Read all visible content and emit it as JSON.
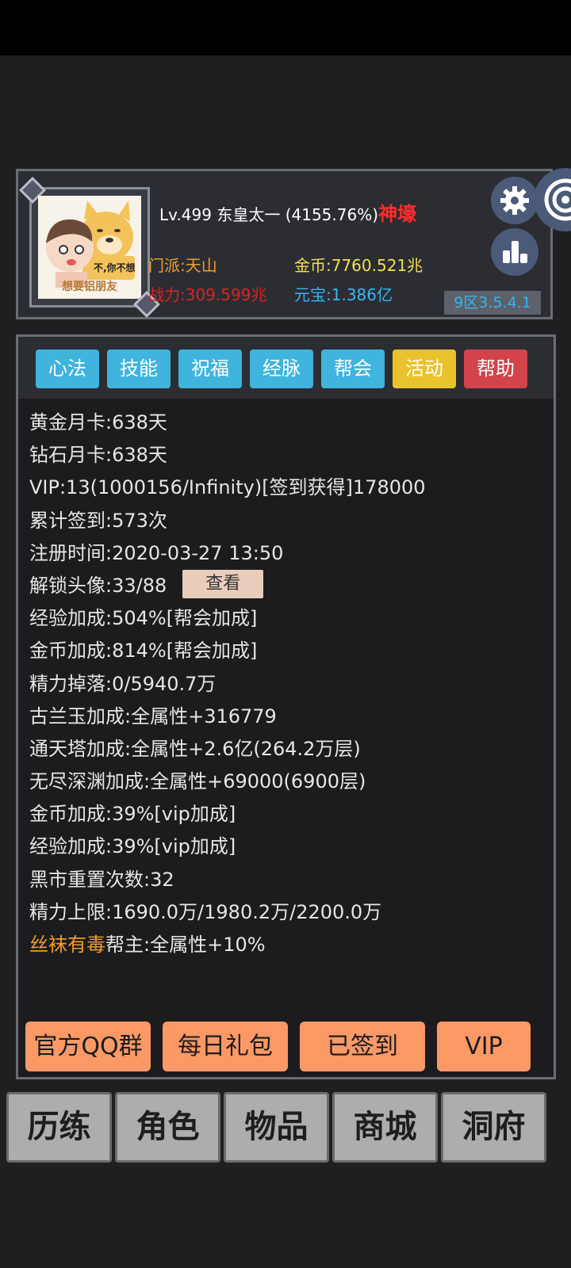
{
  "profile": {
    "level": "Lv.499",
    "name": "东皇太一",
    "percent": "(4155.76%)",
    "title": "神壕",
    "avatar_caption": "想要铝朋友",
    "avatar_bubble": "不,你不想",
    "sect": "门派:天山",
    "gold": "金币:7760.521兆",
    "power": "战力:309.599兆",
    "ingot": "元宝:1.386亿",
    "version": "9区3.5.4.1",
    "icons": {
      "settings": "gear-icon",
      "rank": "bar-chart-icon",
      "swirl": "swirl-icon"
    }
  },
  "tabs": [
    {
      "label": "心法",
      "color": "#3fb4dc"
    },
    {
      "label": "技能",
      "color": "#3fb4dc"
    },
    {
      "label": "祝福",
      "color": "#3fb4dc"
    },
    {
      "label": "经脉",
      "color": "#3fb4dc"
    },
    {
      "label": "帮会",
      "color": "#3fb4dc"
    },
    {
      "label": "活动",
      "color": "#e9c22c"
    },
    {
      "label": "帮助",
      "color": "#d2434a"
    }
  ],
  "info": [
    "黄金月卡:638天",
    "钻石月卡:638天",
    "VIP:13(1000156/Infinity)[签到获得]178000",
    "累计签到:573次",
    "注册时间:2020-03-27 13:50",
    "解锁头像:33/88",
    "经验加成:504%[帮会加成]",
    "金币加成:814%[帮会加成]",
    "精力掉落:0/5940.7万",
    "古兰玉加成:全属性+316779",
    "通天塔加成:全属性+2.6亿(264.2万层)",
    "无尽深渊加成:全属性+69000(6900层)",
    "金币加成:39%[vip加成]",
    "经验加成:39%[vip加成]",
    "黑市重置次数:32",
    "精力上限:1690.0万/1980.2万/2200.0万"
  ],
  "view_button": "查看",
  "leader": {
    "name": "丝袜有毒",
    "text": "帮主:全属性+10%"
  },
  "actions": [
    "官方QQ群",
    "每日礼包",
    "已签到",
    "VIP"
  ],
  "nav": [
    "历练",
    "角色",
    "物品",
    "商城",
    "洞府"
  ],
  "colors": {
    "accent_orange": "#fa9966",
    "tab_blue": "#3fb4dc",
    "title_red": "#ff2b2b"
  }
}
